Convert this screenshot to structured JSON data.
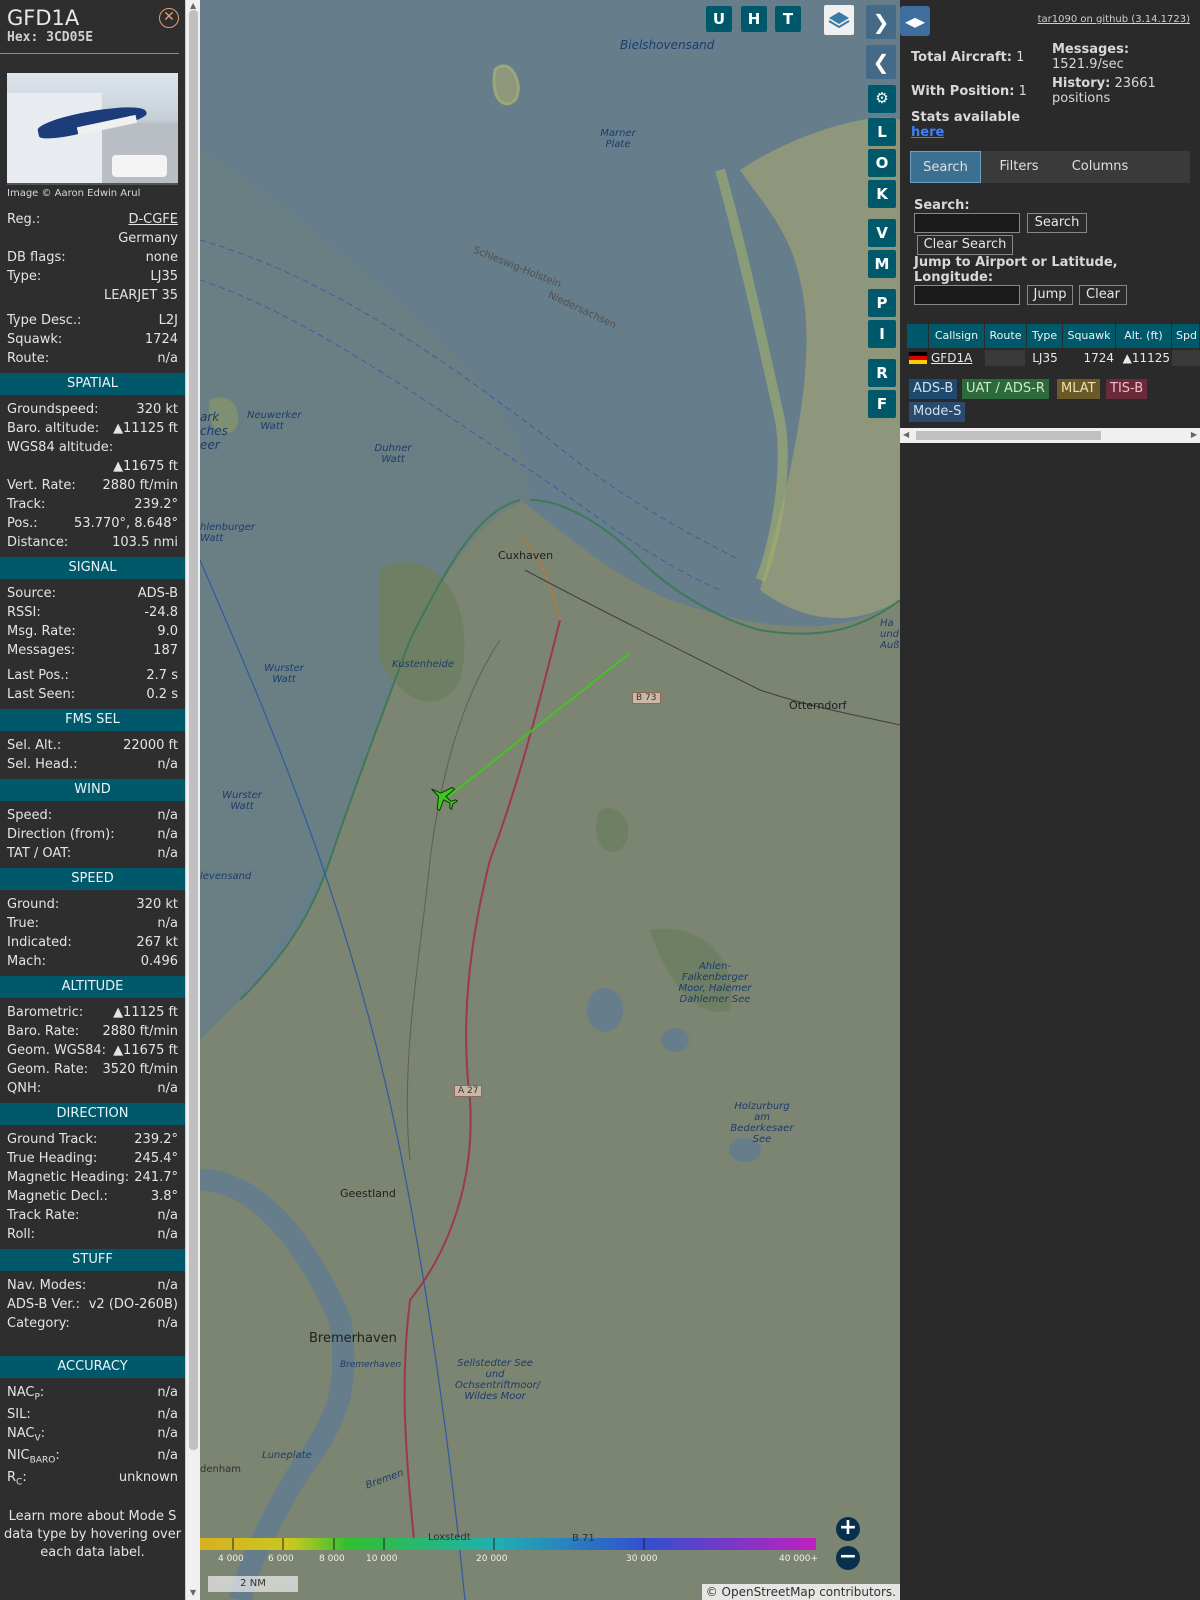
{
  "aircraft": {
    "callsign": "GFD1A",
    "hex_label": "Hex: 3CD05E",
    "photo_credit": "Image © Aaron Edwin Arul"
  },
  "details": {
    "reg_label": "Reg.:",
    "reg": "D-CGFE",
    "country": "Germany",
    "dbflags_label": "DB flags:",
    "dbflags": "none",
    "type_label": "Type:",
    "type": "LJ35",
    "type_full": "LEARJET 35",
    "typedesc_label": "Type Desc.:",
    "typedesc": "L2J",
    "squawk_label": "Squawk:",
    "squawk": "1724",
    "route_label": "Route:",
    "route": "n/a"
  },
  "spatial": {
    "title": "SPATIAL",
    "gs_label": "Groundspeed:",
    "gs": "320 kt",
    "baro_label": "Baro. altitude:",
    "baro": "▲11125 ft",
    "wgs_label": "WGS84 altitude:",
    "wgs": "▲11675 ft",
    "vr_label": "Vert. Rate:",
    "vr": "2880 ft/min",
    "track_label": "Track:",
    "track": "239.2°",
    "pos_label": "Pos.:",
    "pos": "53.770°, 8.648°",
    "dist_label": "Distance:",
    "dist": "103.5 nmi"
  },
  "signal": {
    "title": "SIGNAL",
    "source_label": "Source:",
    "source": "ADS-B",
    "rssi_label": "RSSI:",
    "rssi": "-24.8",
    "rate_label": "Msg. Rate:",
    "rate": "9.0",
    "msgs_label": "Messages:",
    "msgs": "187",
    "lastpos_label": "Last Pos.:",
    "lastpos": "2.7 s",
    "lastseen_label": "Last Seen:",
    "lastseen": "0.2 s"
  },
  "fms": {
    "title": "FMS SEL",
    "selalt_label": "Sel. Alt.:",
    "selalt": "22000 ft",
    "selhead_label": "Sel. Head.:",
    "selhead": "n/a"
  },
  "wind": {
    "title": "WIND",
    "speed_label": "Speed:",
    "speed": "n/a",
    "dir_label": "Direction (from):",
    "dir": "n/a",
    "tat_label": "TAT / OAT:",
    "tat": "n/a"
  },
  "speed": {
    "title": "SPEED",
    "ground_label": "Ground:",
    "ground": "320 kt",
    "true_label": "True:",
    "true": "n/a",
    "ias_label": "Indicated:",
    "ias": "267 kt",
    "mach_label": "Mach:",
    "mach": "0.496"
  },
  "altitude": {
    "title": "ALTITUDE",
    "baro_label": "Barometric:",
    "baro": "▲11125 ft",
    "brate_label": "Baro. Rate:",
    "brate": "2880 ft/min",
    "geom_label": "Geom. WGS84:",
    "geom": "▲11675 ft",
    "grate_label": "Geom. Rate:",
    "grate": "3520 ft/min",
    "qnh_label": "QNH:",
    "qnh": "n/a"
  },
  "direction": {
    "title": "DIRECTION",
    "gt_label": "Ground Track:",
    "gt": "239.2°",
    "th_label": "True Heading:",
    "th": "245.4°",
    "mh_label": "Magnetic Heading:",
    "mh": "241.7°",
    "md_label": "Magnetic Decl.:",
    "md": "3.8°",
    "tr_label": "Track Rate:",
    "tr": "n/a",
    "roll_label": "Roll:",
    "roll": "n/a"
  },
  "stuff": {
    "title": "STUFF",
    "nav_label": "Nav. Modes:",
    "nav": "n/a",
    "adsb_label": "ADS-B Ver.:",
    "adsb": "v2 (DO-260B)",
    "cat_label": "Category:",
    "cat": "n/a"
  },
  "accuracy": {
    "title": "ACCURACY",
    "nacp_label": "NAC",
    "nacp_sub": "P",
    "nacp": "n/a",
    "sil_label": "SIL:",
    "sil": "n/a",
    "nacv_label": "NAC",
    "nacv_sub": "V",
    "nacv": "n/a",
    "nic_label": "NIC",
    "nic_sub": "BARO",
    "nic": "n/a",
    "rc_label": "R",
    "rc_sub": "C",
    "rc": "unknown",
    "note": "Learn more about Mode S data type by hovering over each data label."
  },
  "map": {
    "buttons_top": [
      "U",
      "H",
      "T"
    ],
    "buttons_side": [
      "L",
      "O",
      "K",
      "V",
      "M",
      "P",
      "I",
      "R",
      "F"
    ],
    "labels": {
      "bielshovensand": "Bielshovensand",
      "marner": "Marner Plate",
      "schleswig": "Schleswig-Holstein",
      "niedersachsen": "Niedersachsen",
      "neuwerker": "Neuwerker Watt",
      "duhner": "Duhner Watt",
      "park": "ark ches eer",
      "hlenburger": "hlenburger Watt",
      "cuxhaven": "Cuxhaven",
      "kustenheide": "Kustenheide",
      "wurster1": "Wurster Watt",
      "wurster2": "Wurster Watt",
      "otterndorf": "Otterndorf",
      "b73": "B 73",
      "hau": "Ha und Auße",
      "levensand": "levensand",
      "ahlen": "Ahlen-Falkenberger Moor, Halemer Dahlemer See",
      "a27": "A 27",
      "holzurburg": "Holzurburg am Bederkesaer See",
      "geestland": "Geestland",
      "bremerhaven": "Bremerhaven",
      "bremerhaven_small": "Bremerhaven",
      "sellstedter": "Sellstedter See und Ochsentriftmoor/ Wildes Moor",
      "luneplate": "Luneplate",
      "denham": "denham",
      "bremen": "Bremen",
      "loxstedt": "Loxstedt",
      "b71": "B 71"
    },
    "altitude_legend": [
      "4 000",
      "6 000",
      "8 000",
      "10 000",
      "20 000",
      "30 000",
      "40 000+"
    ],
    "scale": "2 NM",
    "attribution": "© OpenStreetMap contributors."
  },
  "panel": {
    "github": "tar1090 on github (3.14.1723)",
    "total_label": "Total Aircraft:",
    "total": "1",
    "pos_label": "With Position:",
    "pos": "1",
    "msgs_label": "Messages:",
    "msgs": "1521.9/sec",
    "hist_label": "History:",
    "hist": "23661 positions",
    "stats_label": "Stats available",
    "stats_link": "here",
    "tabs": [
      "Search",
      "Filters",
      "Columns"
    ],
    "search_label": "Search:",
    "search_btn": "Search",
    "clear_search_btn": "Clear Search",
    "jump_label": "Jump to Airport or Latitude, Longitude:",
    "jump_btn": "Jump",
    "clear_btn": "Clear",
    "columns": [
      "Callsign",
      "Route",
      "Type",
      "Squawk",
      "Alt. (ft)",
      "Spd"
    ],
    "row": {
      "callsign": "GFD1A",
      "type": "LJ35",
      "squawk": "1724",
      "alt": "▲11125"
    },
    "legend": [
      {
        "label": "ADS-B",
        "color": "#1f4a6e"
      },
      {
        "label": "UAT / ADS-R",
        "color": "#2d6a3a"
      },
      {
        "label": "MLAT",
        "color": "#6a5a2a"
      },
      {
        "label": "TIS-B",
        "color": "#6a2a3a"
      },
      {
        "label": "Mode-S",
        "color": "#2a4a6e"
      }
    ]
  }
}
